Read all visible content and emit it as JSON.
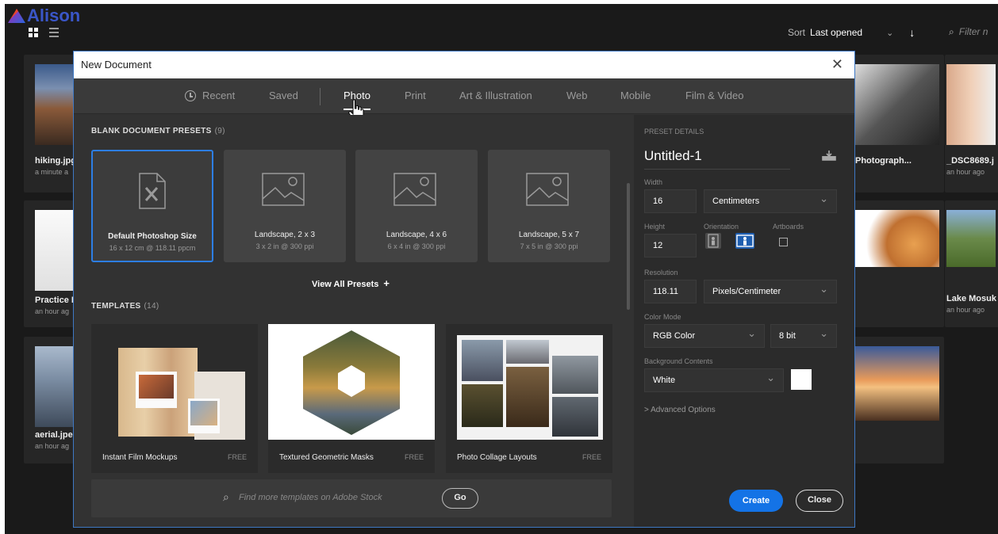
{
  "background_app": {
    "logo_text": "Alison",
    "sort_label": "Sort",
    "sort_value": "Last opened",
    "filter_placeholder": "Filter n",
    "cards": [
      {
        "title": "hiking.jpg",
        "subtitle": "a minute a"
      },
      {
        "title": "Practice F",
        "subtitle": "an hour ag"
      },
      {
        "title": "aerial.jpe",
        "subtitle": "an hour ag"
      },
      {
        "title": "Photograph...",
        "subtitle": ""
      },
      {
        "title": "_DSC8689.j",
        "subtitle": "an hour ago"
      },
      {
        "title": "Lake Mosuk",
        "subtitle": "an hour ago"
      }
    ]
  },
  "dialog": {
    "title": "New Document",
    "close_glyph": "✕",
    "tabs": [
      "Recent",
      "Saved",
      "Photo",
      "Print",
      "Art & Illustration",
      "Web",
      "Mobile",
      "Film & Video"
    ],
    "active_tab": "Photo",
    "presets_heading": "BLANK DOCUMENT PRESETS",
    "presets_count": "(9)",
    "presets": [
      {
        "name": "Default Photoshop Size",
        "desc": "16 x 12 cm @ 118.11 ppcm"
      },
      {
        "name": "Landscape, 2 x 3",
        "desc": "3 x 2 in @ 300 ppi"
      },
      {
        "name": "Landscape, 4 x 6",
        "desc": "6 x 4 in @ 300 ppi"
      },
      {
        "name": "Landscape, 5 x 7",
        "desc": "7 x 5 in @ 300 ppi"
      }
    ],
    "view_all": "View All Presets",
    "templates_heading": "TEMPLATES",
    "templates_count": "(14)",
    "templates": [
      {
        "name": "Instant Film Mockups",
        "badge": "FREE"
      },
      {
        "name": "Textured Geometric Masks",
        "badge": "FREE"
      },
      {
        "name": "Photo Collage Layouts",
        "badge": "FREE"
      }
    ],
    "search_placeholder": "Find more templates on Adobe Stock",
    "go_label": "Go",
    "details": {
      "heading": "PRESET DETAILS",
      "doc_name": "Untitled-1",
      "width_label": "Width",
      "width_value": "16",
      "width_unit": "Centimeters",
      "height_label": "Height",
      "height_value": "12",
      "orientation_label": "Orientation",
      "artboards_label": "Artboards",
      "resolution_label": "Resolution",
      "resolution_value": "118.11",
      "resolution_unit": "Pixels/Centimeter",
      "color_mode_label": "Color Mode",
      "color_mode_value": "RGB Color",
      "bit_depth": "8 bit",
      "background_label": "Background Contents",
      "background_value": "White",
      "advanced": "> Advanced Options"
    },
    "create_label": "Create",
    "close_label": "Close"
  },
  "colors": {
    "accent": "#1473e6",
    "selection_border": "#2d7ee4",
    "panel": "#323232",
    "details_panel": "#2b2b2b"
  }
}
